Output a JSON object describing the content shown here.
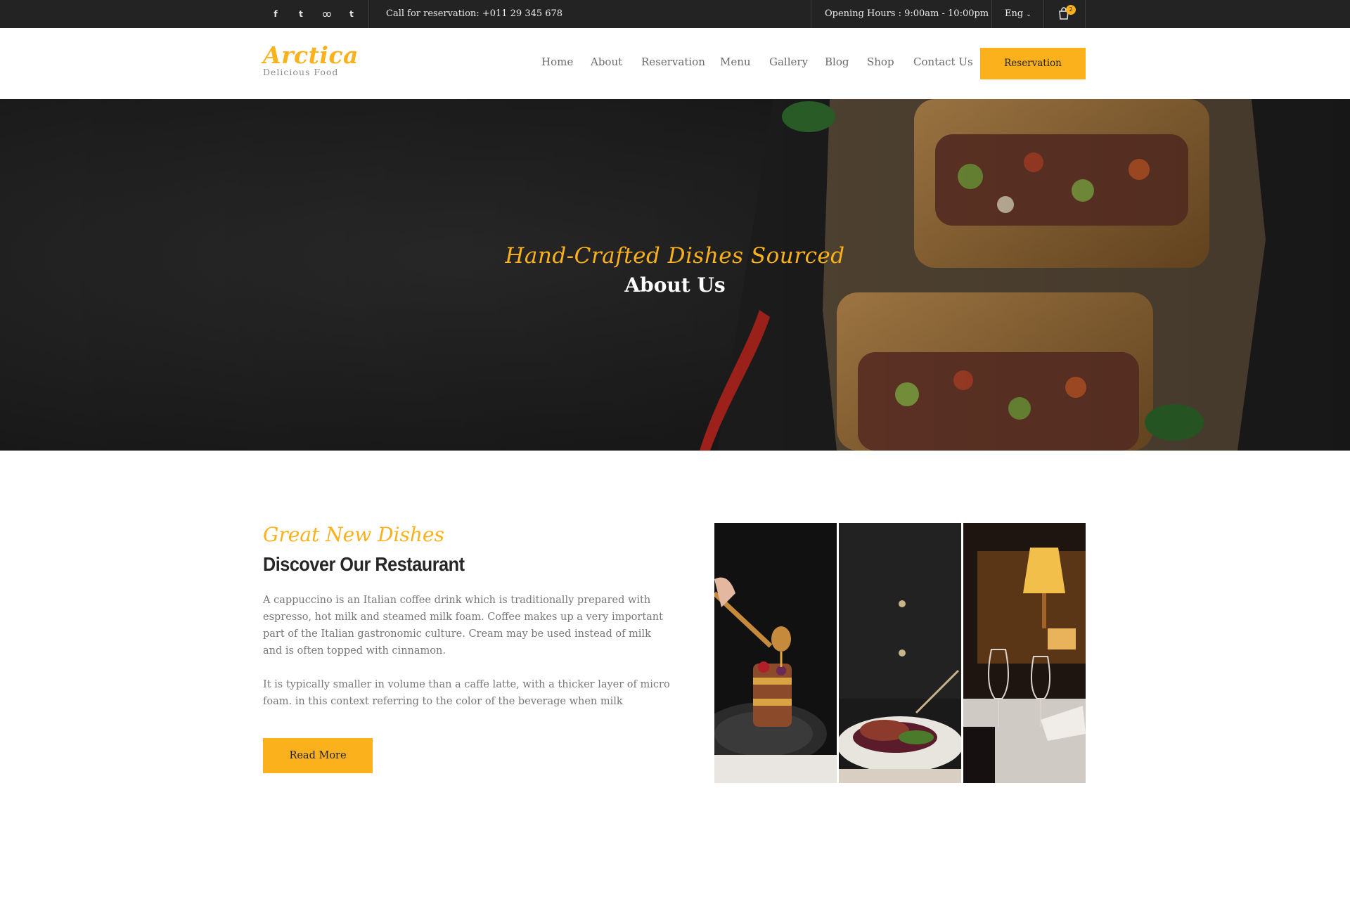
{
  "topbar": {
    "social": [
      {
        "name": "facebook-icon",
        "glyph": "f"
      },
      {
        "name": "twitter-icon",
        "glyph": "t"
      },
      {
        "name": "tripadvisor-icon",
        "glyph": "oo"
      },
      {
        "name": "tumblr-icon",
        "glyph": "t"
      }
    ],
    "call": "Call for reservation: +011 29 345 678",
    "hours": "Opening Hours : 9:00am - 10:00pm",
    "language": "Eng",
    "cart_count": "2"
  },
  "header": {
    "brand": "Arctica",
    "tagline": "Delicious Food",
    "nav": [
      "Home",
      "About",
      "Reservation",
      "Menu",
      "Gallery",
      "Blog",
      "Shop",
      "Contact Us"
    ],
    "cta": "Reservation"
  },
  "hero": {
    "subtitle": "Hand-Crafted Dishes Sourced",
    "title": "About Us"
  },
  "about": {
    "kicker": "Great New Dishes",
    "heading": "Discover Our Restaurant",
    "paragraph1": "A cappuccino is an Italian coffee drink which is traditionally prepared with espresso, hot milk and steamed milk foam. Coffee makes up a very important part of the Italian gastronomic culture. Cream may be used instead of milk and is often topped with cinnamon.",
    "paragraph2": "It is typically smaller in volume than a caffe latte, with a thicker layer of micro foam. in this context referring to the color of the beverage when milk",
    "button": "Read More"
  },
  "colors": {
    "accent": "#fbb11b",
    "topbar": "#232323",
    "heading": "#262626",
    "body_text": "#777777"
  }
}
